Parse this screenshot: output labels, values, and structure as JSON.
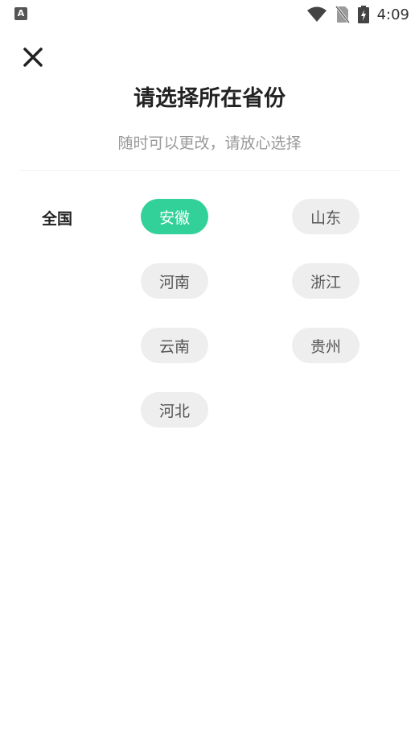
{
  "status_bar": {
    "app_icon_letter": "A",
    "time": "4:09"
  },
  "header": {
    "title": "请选择所在省份",
    "subtitle": "随时可以更改，请放心选择"
  },
  "region": {
    "label": "全国"
  },
  "provinces": [
    {
      "name": "安徽",
      "selected": true
    },
    {
      "name": "山东",
      "selected": false
    },
    {
      "name": "河南",
      "selected": false
    },
    {
      "name": "浙江",
      "selected": false
    },
    {
      "name": "云南",
      "selected": false
    },
    {
      "name": "贵州",
      "selected": false
    },
    {
      "name": "河北",
      "selected": false
    }
  ],
  "colors": {
    "accent": "#33d19a",
    "chip_bg": "#eeeeee",
    "title": "#222222",
    "subtitle": "#999999"
  }
}
